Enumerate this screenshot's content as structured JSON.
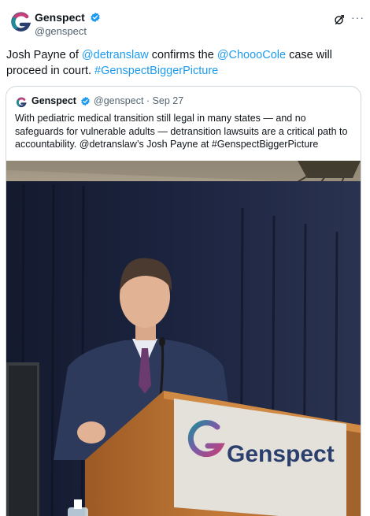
{
  "tweet": {
    "author_name": "Genspect",
    "author_handle": "@genspect",
    "verified": true,
    "text_parts": [
      "Josh Payne of ",
      "@detranslaw",
      " confirms the ",
      "@ChoooCole",
      " case will proceed in court. ",
      "#GenspectBiggerPicture"
    ],
    "icons": [
      "grok-icon",
      "more-icon"
    ],
    "more_glyph": "···"
  },
  "quoted_tweet": {
    "author_name": "Genspect",
    "author_handle": "@genspect",
    "verified": true,
    "meta": "@genspect · Sep 27",
    "text": "With pediatric medical transition still legal in many states — and no safeguards for vulnerable adults — detransition lawsuits are a critical path to accountability. @detranslaw’s Josh Payne at #GenspectBiggerPicture",
    "image": {
      "podium_sign_text": "Genspect"
    }
  },
  "colors": {
    "link": "#1d9bf0",
    "verified": "#1d9bf0",
    "text": "#0f1419",
    "secondary": "#536471",
    "border": "#cfd9de",
    "brand_teal": "#1f8a9a",
    "brand_purple": "#7b5aa6",
    "brand_magenta": "#c2417a",
    "brand_navy": "#2b3f6e"
  }
}
